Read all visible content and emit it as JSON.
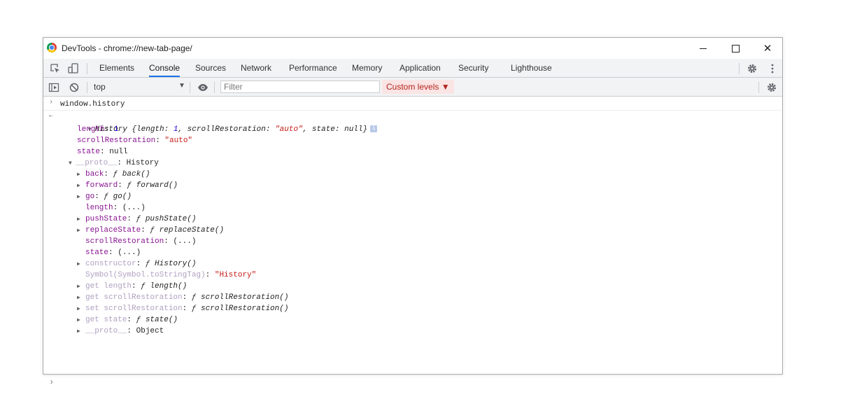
{
  "window": {
    "title": "DevTools - chrome://new-tab-page/"
  },
  "tabs": [
    "Elements",
    "Console",
    "Sources",
    "Network",
    "Performance",
    "Memory",
    "Application",
    "Security",
    "Lighthouse"
  ],
  "active_tab": "Console",
  "filterbar": {
    "context": "top",
    "filter_placeholder": "Filter",
    "levels": "Custom levels ▼"
  },
  "console": {
    "command": "window.history",
    "summary": {
      "head": "History ",
      "brace_open": "{length: ",
      "len": "1",
      "sr_key": ", scrollRestoration: ",
      "sr_val": "\"auto\"",
      "state_key": ", state: ",
      "state_val": "null",
      "brace_close": "}"
    },
    "props": [
      {
        "k": "length",
        "v": "1"
      },
      {
        "k": "scrollRestoration",
        "v": "\"auto\""
      },
      {
        "k": "state",
        "v": "null"
      }
    ],
    "proto_key": "__proto__",
    "proto_val": "History",
    "proto_items": [
      {
        "k": "back",
        "v": "ƒ back()",
        "expand": true
      },
      {
        "k": "forward",
        "v": "ƒ forward()",
        "expand": true
      },
      {
        "k": "go",
        "v": "ƒ go()",
        "expand": true
      },
      {
        "k": "length",
        "v": "(...)",
        "expand": false
      },
      {
        "k": "pushState",
        "v": "ƒ pushState()",
        "expand": true
      },
      {
        "k": "replaceState",
        "v": "ƒ replaceState()",
        "expand": true
      },
      {
        "k": "scrollRestoration",
        "v": "(...)",
        "expand": false
      },
      {
        "k": "state",
        "v": "(...)",
        "expand": false
      },
      {
        "k": "constructor",
        "v": "ƒ History()",
        "expand": true
      },
      {
        "k": "Symbol(Symbol.toStringTag)",
        "v": "\"History\"",
        "expand": false
      },
      {
        "k": "get length",
        "v": "ƒ length()",
        "expand": true
      },
      {
        "k": "get scrollRestoration",
        "v": "ƒ scrollRestoration()",
        "expand": true
      },
      {
        "k": "set scrollRestoration",
        "v": "ƒ scrollRestoration()",
        "expand": true
      },
      {
        "k": "get state",
        "v": "ƒ state()",
        "expand": true
      },
      {
        "k": "__proto__",
        "v": "Object",
        "expand": true
      }
    ]
  }
}
